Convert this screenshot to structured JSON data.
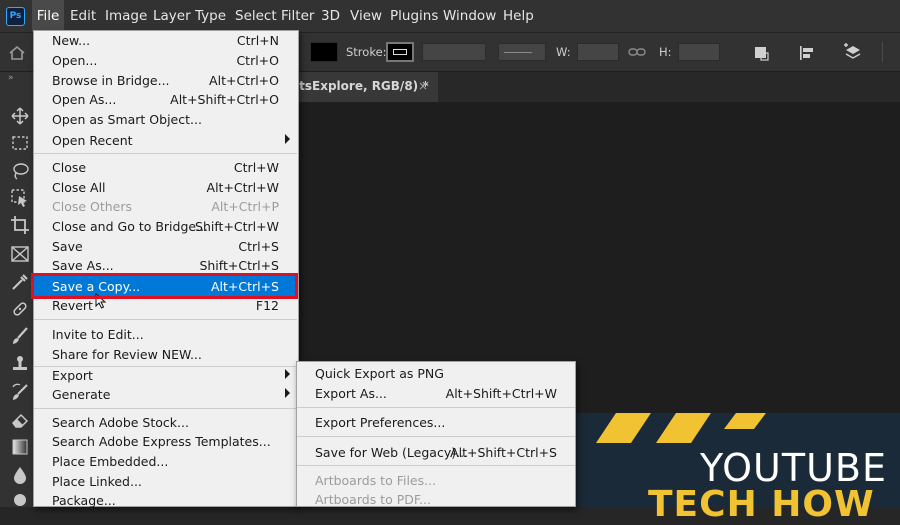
{
  "app": {
    "logo": "Ps"
  },
  "menubar": {
    "items": [
      "File",
      "Edit",
      "Image",
      "Layer",
      "Type",
      "Select",
      "Filter",
      "3D",
      "View",
      "Plugins",
      "Window",
      "Help"
    ]
  },
  "options_bar": {
    "stroke_label": "Stroke:",
    "w_label": "W:",
    "h_label": "H:"
  },
  "document_tab": {
    "title": "etsExplore, RGB/8) *",
    "close": "×"
  },
  "file_menu": {
    "items": [
      {
        "label": "New...",
        "shortcut": "Ctrl+N"
      },
      {
        "label": "Open...",
        "shortcut": "Ctrl+O"
      },
      {
        "label": "Browse in Bridge...",
        "shortcut": "Alt+Ctrl+O"
      },
      {
        "label": "Open As...",
        "shortcut": "Alt+Shift+Ctrl+O"
      },
      {
        "label": "Open as Smart Object...",
        "shortcut": ""
      },
      {
        "label": "Open Recent",
        "shortcut": ""
      },
      {
        "label": "Close",
        "shortcut": "Ctrl+W"
      },
      {
        "label": "Close All",
        "shortcut": "Alt+Ctrl+W"
      },
      {
        "label": "Close Others",
        "shortcut": "Alt+Ctrl+P"
      },
      {
        "label": "Close and Go to Bridge...",
        "shortcut": "Shift+Ctrl+W"
      },
      {
        "label": "Save",
        "shortcut": "Ctrl+S"
      },
      {
        "label": "Save As...",
        "shortcut": "Shift+Ctrl+S"
      },
      {
        "label": "Save a Copy...",
        "shortcut": "Alt+Ctrl+S"
      },
      {
        "label": "Revert",
        "shortcut": "F12"
      },
      {
        "label": "Invite to Edit...",
        "shortcut": ""
      },
      {
        "label": "Share for Review NEW...",
        "shortcut": ""
      },
      {
        "label": "Export",
        "shortcut": ""
      },
      {
        "label": "Generate",
        "shortcut": ""
      },
      {
        "label": "Search Adobe Stock...",
        "shortcut": ""
      },
      {
        "label": "Search Adobe Express Templates...",
        "shortcut": ""
      },
      {
        "label": "Place Embedded...",
        "shortcut": ""
      },
      {
        "label": "Place Linked...",
        "shortcut": ""
      },
      {
        "label": "Package...",
        "shortcut": ""
      }
    ]
  },
  "export_submenu": {
    "items": [
      {
        "label": "Quick Export as PNG",
        "shortcut": ""
      },
      {
        "label": "Export As...",
        "shortcut": "Alt+Shift+Ctrl+W"
      },
      {
        "label": "Export Preferences...",
        "shortcut": ""
      },
      {
        "label": "Save for Web (Legacy)...",
        "shortcut": "Alt+Shift+Ctrl+S"
      },
      {
        "label": "Artboards to Files...",
        "shortcut": ""
      },
      {
        "label": "Artboards to PDF...",
        "shortcut": ""
      }
    ]
  },
  "thumbnail": {
    "line1": "YOUTUBE",
    "line2": "TECH HOW"
  },
  "colors": {
    "highlight": "#0078d7",
    "annotation_box": "#e01022",
    "accent": "#31a8ff",
    "thumbnail_yellow": "#f1c232"
  }
}
